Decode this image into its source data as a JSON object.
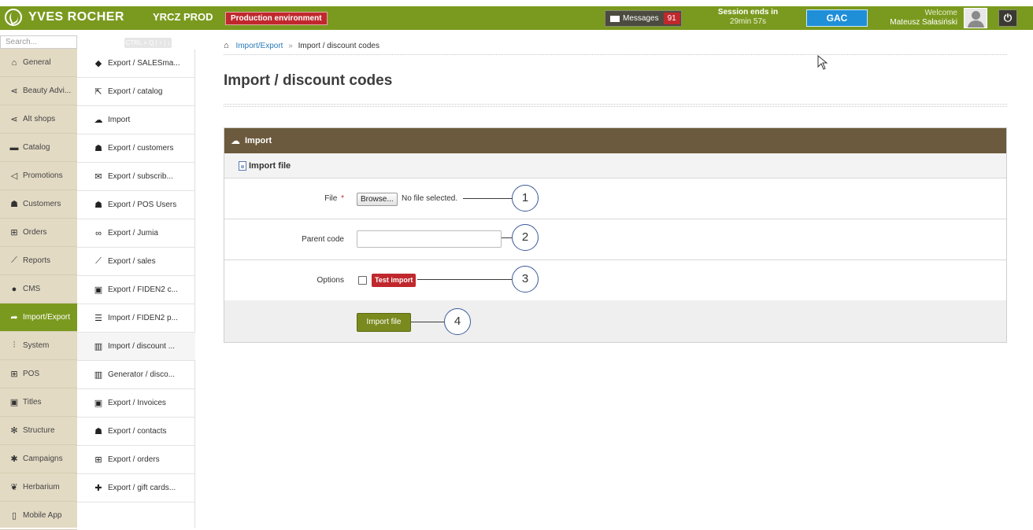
{
  "header": {
    "brand": "YVES ROCHER",
    "env_name": "YRCZ PROD",
    "env_badge": "Production environment",
    "messages_label": "Messages",
    "messages_count": "91",
    "session_label": "Session ends in",
    "session_time": "29min 57s",
    "gac_label": "GAC",
    "welcome_label": "Welcome",
    "user_name": "Mateusz Sałasiński",
    "power_glyph": "⏻"
  },
  "search": {
    "placeholder": "Search...",
    "shortcut": "CTRL + Q | ↑ | ↓"
  },
  "sidebar": {
    "items": [
      {
        "label": "General",
        "icon": "home-icon",
        "glyph": "⌂"
      },
      {
        "label": "Beauty Advi...",
        "icon": "share-icon",
        "glyph": "⋖"
      },
      {
        "label": "Alt shops",
        "icon": "share-icon",
        "glyph": "⋖"
      },
      {
        "label": "Catalog",
        "icon": "folder-icon",
        "glyph": "▬"
      },
      {
        "label": "Promotions",
        "icon": "megaphone-icon",
        "glyph": "◁"
      },
      {
        "label": "Customers",
        "icon": "users-icon",
        "glyph": "☗"
      },
      {
        "label": "Orders",
        "icon": "cart-icon",
        "glyph": "⊞"
      },
      {
        "label": "Reports",
        "icon": "chart-icon",
        "glyph": "⟋"
      },
      {
        "label": "CMS",
        "icon": "globe-icon",
        "glyph": "●"
      },
      {
        "label": "Import/Export",
        "icon": "share-arrow-icon",
        "glyph": "➦"
      },
      {
        "label": "System",
        "icon": "sliders-icon",
        "glyph": "⫶"
      },
      {
        "label": "POS",
        "icon": "cart-icon",
        "glyph": "⊞"
      },
      {
        "label": "Titles",
        "icon": "id-card-icon",
        "glyph": "▣"
      },
      {
        "label": "Structure",
        "icon": "cogs-icon",
        "glyph": "✻"
      },
      {
        "label": "Campaigns",
        "icon": "asterisk-icon",
        "glyph": "✱"
      },
      {
        "label": "Herbarium",
        "icon": "leaf-icon",
        "glyph": "❦"
      },
      {
        "label": "Mobile App",
        "icon": "mobile-icon",
        "glyph": "▯"
      }
    ]
  },
  "submenu": {
    "items": [
      {
        "label": "Export / SALESma...",
        "icon": "tag-icon",
        "glyph": "◆"
      },
      {
        "label": "Export / catalog",
        "icon": "external-link-icon",
        "glyph": "⇱"
      },
      {
        "label": "Import",
        "icon": "cloud-upload-icon",
        "glyph": "☁"
      },
      {
        "label": "Export / customers",
        "icon": "users-icon",
        "glyph": "☗"
      },
      {
        "label": "Export / subscrib...",
        "icon": "envelope-icon",
        "glyph": "✉"
      },
      {
        "label": "Export / POS Users",
        "icon": "user-icon",
        "glyph": "☗"
      },
      {
        "label": "Export / Jumia",
        "icon": "link-icon",
        "glyph": "∞"
      },
      {
        "label": "Export / sales",
        "icon": "chart-icon",
        "glyph": "⟋"
      },
      {
        "label": "Export / FIDEN2 c...",
        "icon": "id-card-icon",
        "glyph": "▣"
      },
      {
        "label": "Import / FIDEN2 p...",
        "icon": "list-icon",
        "glyph": "☰"
      },
      {
        "label": "Import / discount ...",
        "icon": "barcode-icon",
        "glyph": "▥"
      },
      {
        "label": "Generator / disco...",
        "icon": "barcode-icon",
        "glyph": "▥"
      },
      {
        "label": "Export / Invoices",
        "icon": "id-card-icon",
        "glyph": "▣"
      },
      {
        "label": "Export / contacts",
        "icon": "users-icon",
        "glyph": "☗"
      },
      {
        "label": "Export / orders",
        "icon": "cart-icon",
        "glyph": "⊞"
      },
      {
        "label": "Export / gift cards...",
        "icon": "gift-icon",
        "glyph": "✚"
      }
    ]
  },
  "breadcrumb": {
    "home_glyph": "⌂",
    "link": "Import/Export",
    "separator": "»",
    "current": "Import / discount codes"
  },
  "page": {
    "title": "Import / discount codes"
  },
  "panel": {
    "title": "Import",
    "title_glyph": "☁",
    "section": "Import file",
    "file_label": "File",
    "required_mark": "*",
    "browse_label": "Browse...",
    "file_status": "No file selected.",
    "parent_code_label": "Parent code",
    "parent_code_value": "",
    "options_label": "Options",
    "test_import_label": "Test import",
    "submit_label": "Import file"
  },
  "callouts": [
    "1",
    "2",
    "3",
    "4"
  ],
  "colors": {
    "brand_green": "#7a9a1f",
    "panel_brown": "#6b5a3d",
    "danger_red": "#c0282d",
    "gac_blue": "#1f8fd8",
    "link_blue": "#2a7ab8"
  }
}
